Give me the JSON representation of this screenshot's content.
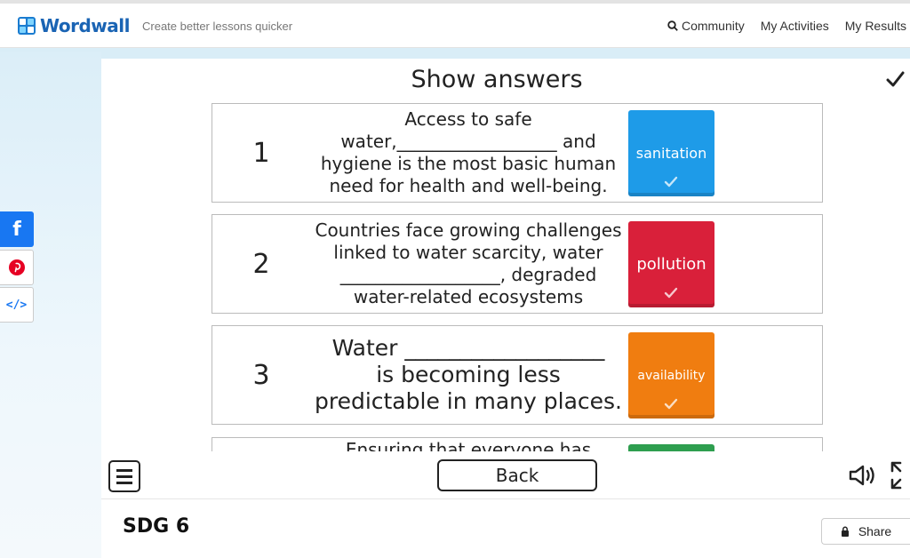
{
  "header": {
    "logo_text": "Wordwall",
    "tagline": "Create better lessons quicker",
    "nav": {
      "community": "Community",
      "my_activities": "My Activities",
      "my_results": "My Results"
    }
  },
  "social": {
    "facebook": "f",
    "embed": "</>"
  },
  "game": {
    "title": "Show answers",
    "cards": [
      {
        "number": "1",
        "lines": [
          "Access to safe",
          "water,__________________ and",
          "hygiene is the most basic human",
          "need for health and well-being."
        ],
        "answer": "sanitation",
        "color": "#1e9be8"
      },
      {
        "number": "2",
        "lines": [
          "Countries face growing challenges",
          "linked to water scarcity, water",
          "__________________, degraded",
          "water-related ecosystems"
        ],
        "answer": "pollution",
        "color": "#d9203a"
      },
      {
        "number": "3",
        "lines": [
          "Water __________________",
          "is becoming less",
          "predictable in many places."
        ],
        "answer": "availability",
        "color": "#f07d10"
      },
      {
        "number": "",
        "lines": [
          "Ensuring that everyone has"
        ],
        "answer": "",
        "color": "#2e9e4f"
      }
    ],
    "back_label": "Back"
  },
  "footer": {
    "activity_title": "SDG 6",
    "share_label": "Share"
  }
}
